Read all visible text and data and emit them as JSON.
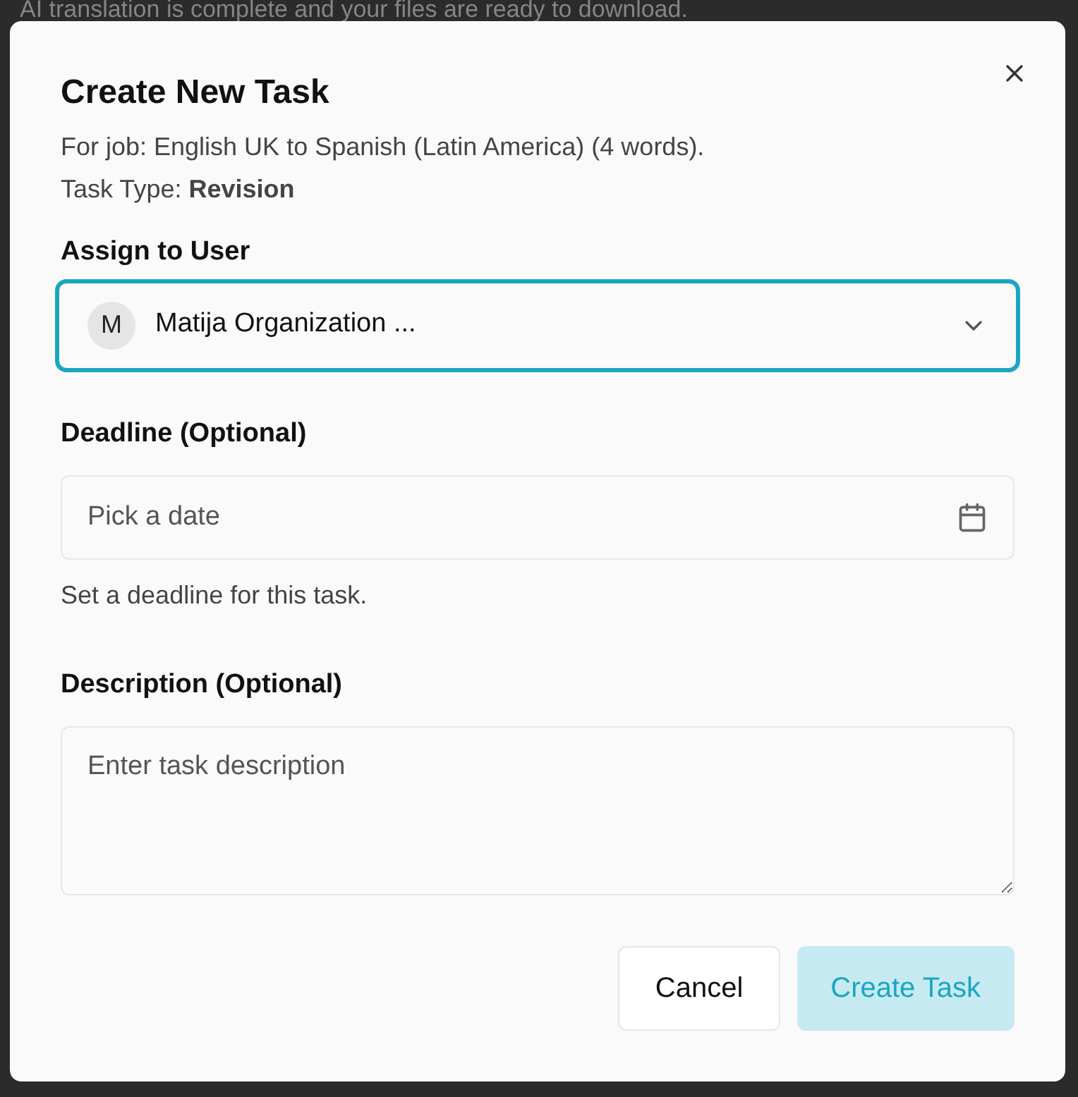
{
  "background": {
    "notice": "AI translation is complete and your files are ready to download."
  },
  "dialog": {
    "title": "Create New Task",
    "job_line": "For job: English UK to Spanish (Latin America) (4 words).",
    "task_type_line": "Task Type: **Revision**",
    "assign": {
      "label": "Assign to User",
      "avatar": "M",
      "value": "Matija Organization ...",
      "focused": true
    },
    "deadline": {
      "label": "Deadline (Optional)",
      "placeholder": "Pick a date",
      "help": "Set a deadline for this task."
    },
    "description": {
      "label": "Description (Optional)",
      "placeholder": "Enter task description"
    },
    "buttons": [
      {
        "label": "Cancel",
        "kind": "secondary"
      },
      {
        "label": "Create Task",
        "kind": "primary",
        "disabled": true
      }
    ]
  }
}
